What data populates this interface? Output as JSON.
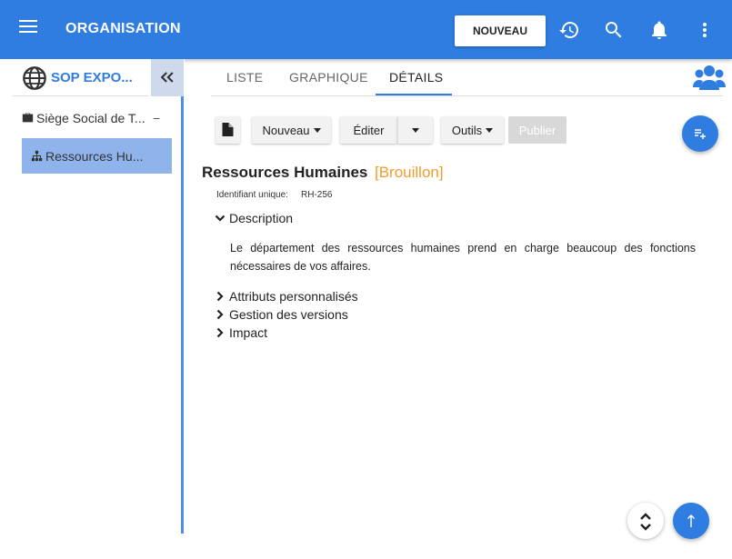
{
  "header": {
    "title": "ORGANISATION",
    "new_button": "NOUVEAU",
    "icons": [
      "menu-icon",
      "history-icon",
      "search-icon",
      "bell-icon",
      "more-vert-icon"
    ]
  },
  "sidebar": {
    "org_name": "SOP EXPO...",
    "tree": [
      {
        "label": "Siège Social de T...",
        "icon": "briefcase-icon",
        "toggle": "−"
      },
      {
        "label": "Ressources Hu...",
        "icon": "sitemap-icon",
        "selected": true
      }
    ]
  },
  "tabs": [
    {
      "label": "LISTE"
    },
    {
      "label": "GRAPHIQUE"
    },
    {
      "label": "DÉTAILS",
      "active": true
    }
  ],
  "toolbar": {
    "nouveau": "Nouveau",
    "editer": "Éditer",
    "outils": "Outils",
    "publier": "Publier"
  },
  "entity": {
    "name": "Ressources Humaines",
    "status": "[Brouillon]",
    "uid_label": "Identifiant unique:",
    "uid_value": "RH-256",
    "sections": {
      "description": "Description",
      "attributes": "Attributs personnalisés",
      "versions": "Gestion des versions",
      "impact": "Impact"
    },
    "description_text": "Le département des ressources humaines prend en charge beaucoup des fonctions nécessaires de vos affaires."
  },
  "colors": {
    "primary": "#2f7de1",
    "status": "#f39c2b",
    "selected_row": "#8fb4ec"
  }
}
